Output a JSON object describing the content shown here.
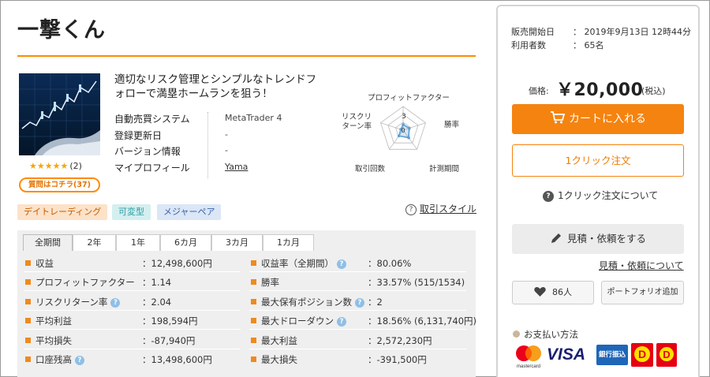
{
  "product": {
    "title": "一撃くん",
    "tagline": "適切なリスク管理とシンプルなトレンドフォローで満塁ホームランを狙う！",
    "stars": "★★★★★",
    "review_count": "(2)",
    "qa_button": "質問はコチラ(37)"
  },
  "info": [
    {
      "label": "自動売買システム",
      "value": "MetaTrader 4"
    },
    {
      "label": "登録更新日",
      "value": "-"
    },
    {
      "label": "バージョン情報",
      "value": "-"
    },
    {
      "label": "マイプロフィール",
      "value": "Yama"
    }
  ],
  "radar": {
    "scale_max": "3",
    "center_value": "0",
    "labels": [
      "プロフィットファクター",
      "勝率",
      "計測期間",
      "取引回数",
      "リスクリターン率"
    ],
    "values": [
      0.7,
      0.8,
      1.2,
      0.9,
      0.3
    ]
  },
  "tags": [
    "デイトレーディング",
    "可変型",
    "メジャーペア"
  ],
  "trade_style_link": "取引スタイル",
  "tabs": [
    "全期間",
    "2年",
    "1年",
    "6カ月",
    "3カ月",
    "1カ月"
  ],
  "active_tab": "全期間",
  "stats_left": [
    {
      "label": "収益",
      "value": "：12,498,600円",
      "help": false
    },
    {
      "label": "プロフィットファクター",
      "value": "：1.14",
      "help": false
    },
    {
      "label": "リスクリターン率",
      "value": "：2.04",
      "help": true
    },
    {
      "label": "平均利益",
      "value": "：198,594円",
      "help": false
    },
    {
      "label": "平均損失",
      "value": "：-87,940円",
      "help": false
    },
    {
      "label": "口座残高",
      "value": "：13,498,600円",
      "help": true
    }
  ],
  "stats_right": [
    {
      "label": "収益率（全期間）",
      "value": "：80.06%",
      "help": true
    },
    {
      "label": "勝率",
      "value": "：33.57% (515/1534)",
      "help": false
    },
    {
      "label": "最大保有ポジション数",
      "value": "：2",
      "help": true
    },
    {
      "label": "最大ドローダウン",
      "value": "：18.56% (6,131,740円)",
      "help": true
    },
    {
      "label": "最大利益",
      "value": "：2,572,230円",
      "help": false
    },
    {
      "label": "最大損失",
      "value": "：-391,500円",
      "help": false
    }
  ],
  "sidebar": {
    "sale_start_label": "販売開始日",
    "sale_start_value": "：  2019年9月13日 12時44分",
    "users_label": "利用者数",
    "users_value": "：  65名",
    "price_label": "価格:",
    "price": "￥20,000",
    "tax": "(税込)",
    "cart_button": "カートに入れる",
    "oneclick_button": "1クリック注文",
    "oneclick_about": "1クリック注文について",
    "quote_button": "見積・依頼をする",
    "quote_link": "見積・依頼について",
    "fav_count": "86人",
    "portfolio_button": "ポートフォリオ追加",
    "payment_title": "お支払い方法",
    "payment_visa": "VISA",
    "payment_bank": "銀行振込",
    "payment_mastercard": "mastercard"
  },
  "colors": {
    "accent": "#f5830f",
    "title_rule": "#ff8a00",
    "stat_bullet": "#f08a1c",
    "help_badge": "#8fbfe6",
    "radar_line": "#5aa0d8"
  }
}
